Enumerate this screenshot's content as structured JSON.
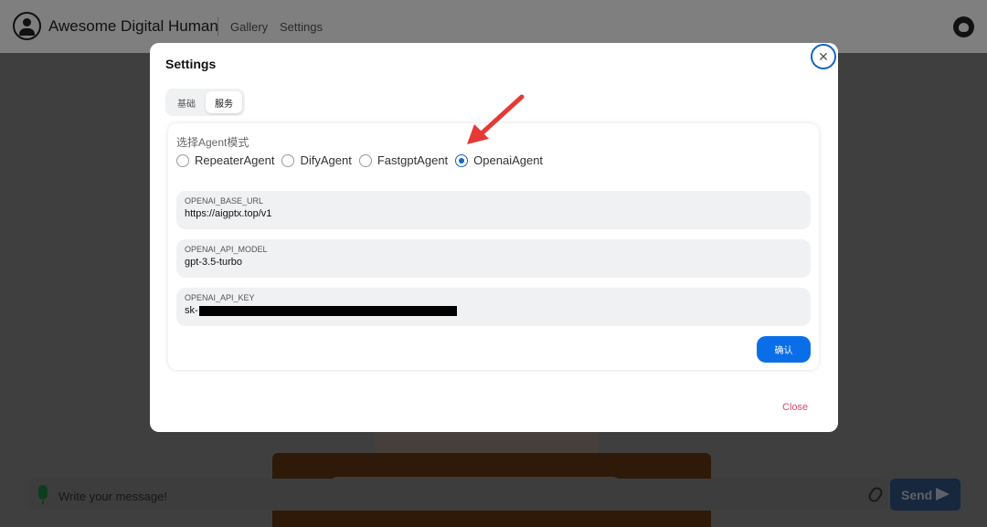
{
  "navbar": {
    "title": "Awesome Digital Human",
    "links": [
      "Gallery",
      "Settings"
    ]
  },
  "chat": {
    "placeholder": "Write your message!",
    "send_label": "Send"
  },
  "modal": {
    "title": "Settings",
    "tabs": [
      {
        "label": "基础",
        "active": false
      },
      {
        "label": "服务",
        "active": true
      }
    ],
    "agent_mode_label": "选择Agent模式",
    "agent_options": [
      {
        "label": "RepeaterAgent",
        "selected": false
      },
      {
        "label": "DifyAgent",
        "selected": false
      },
      {
        "label": "FastgptAgent",
        "selected": false
      },
      {
        "label": "OpenaiAgent",
        "selected": true
      }
    ],
    "fields": [
      {
        "label": "OPENAI_BASE_URL",
        "value": "https://aigptx.top/v1"
      },
      {
        "label": "OPENAI_API_MODEL",
        "value": "gpt-3.5-turbo"
      },
      {
        "label": "OPENAI_API_KEY",
        "value": "sk-"
      }
    ],
    "confirm_label": "确认",
    "close_label": "Close"
  },
  "colors": {
    "accent": "#0a6ee8",
    "radio_selected": "#1565c0",
    "close_link": "#e04a6b",
    "annotation_arrow": "#e53935"
  }
}
